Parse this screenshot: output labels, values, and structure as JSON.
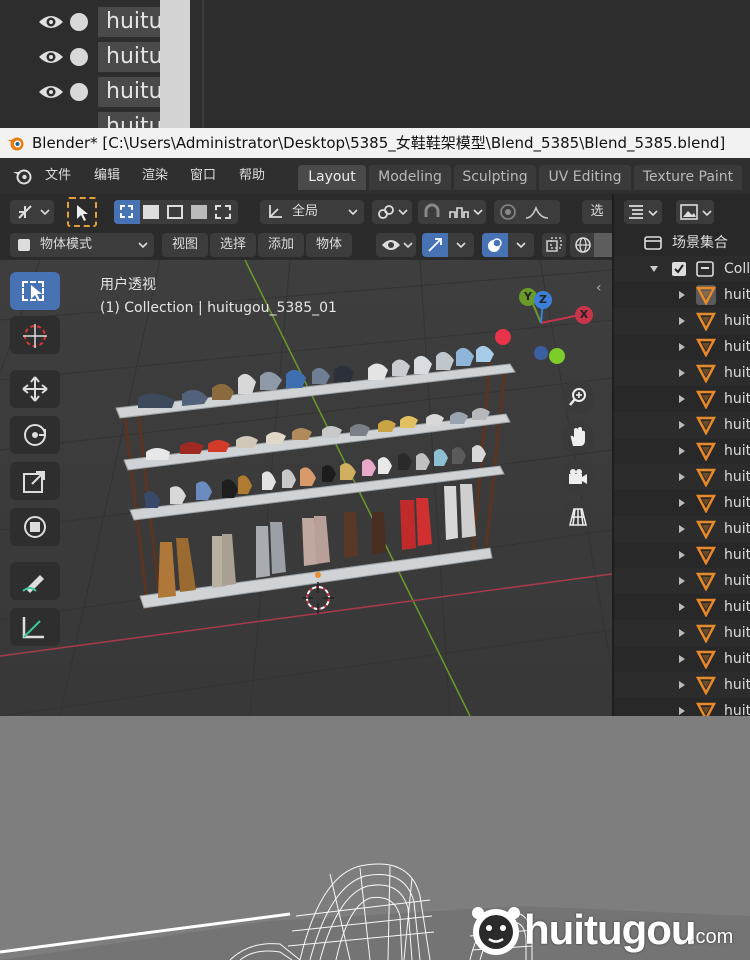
{
  "top_outliner": {
    "rows": [
      {
        "name": "huitu"
      },
      {
        "name": "huitu"
      },
      {
        "name": "huitu"
      },
      {
        "name": "huitu"
      }
    ]
  },
  "titlebar": {
    "title": "Blender* [C:\\Users\\Administrator\\Desktop\\5385_女鞋鞋架模型\\Blend_5385\\Blend_5385.blend]"
  },
  "menubar": {
    "items": [
      "文件",
      "编辑",
      "渲染",
      "窗口",
      "帮助"
    ],
    "workspace_tabs": [
      {
        "label": "Layout",
        "active": true
      },
      {
        "label": "Modeling",
        "active": false
      },
      {
        "label": "Sculpting",
        "active": false
      },
      {
        "label": "UV Editing",
        "active": false
      },
      {
        "label": "Texture Paint",
        "active": false
      }
    ]
  },
  "toolbar": {
    "orientation_label": "全局",
    "select_label": "选",
    "mode_label": "物体模式",
    "menu": [
      "视图",
      "选择",
      "添加",
      "物体"
    ]
  },
  "viewport": {
    "view_name": "用户透视",
    "collection_info": "(1) Collection | huitugou_5385_01",
    "gizmo_axes": {
      "x": "X",
      "y": "Y",
      "z": "Z"
    },
    "colors": {
      "x_axis": "#c8344a",
      "y_axis": "#6a9a2a",
      "z_axis": "#3b7fd8"
    },
    "shelf_tiers": 4
  },
  "outliner": {
    "header": "场景集合",
    "collection": "Colle",
    "items": [
      "huitu",
      "huitu",
      "huitu",
      "huitu",
      "huitu",
      "huitu",
      "huitu",
      "huitu",
      "huitu",
      "huitu",
      "huitu",
      "huitu",
      "huitu",
      "huitu",
      "huitu",
      "huitu",
      "huitu"
    ]
  },
  "watermark": {
    "brand": "huitugou",
    "suffix": ".com"
  }
}
